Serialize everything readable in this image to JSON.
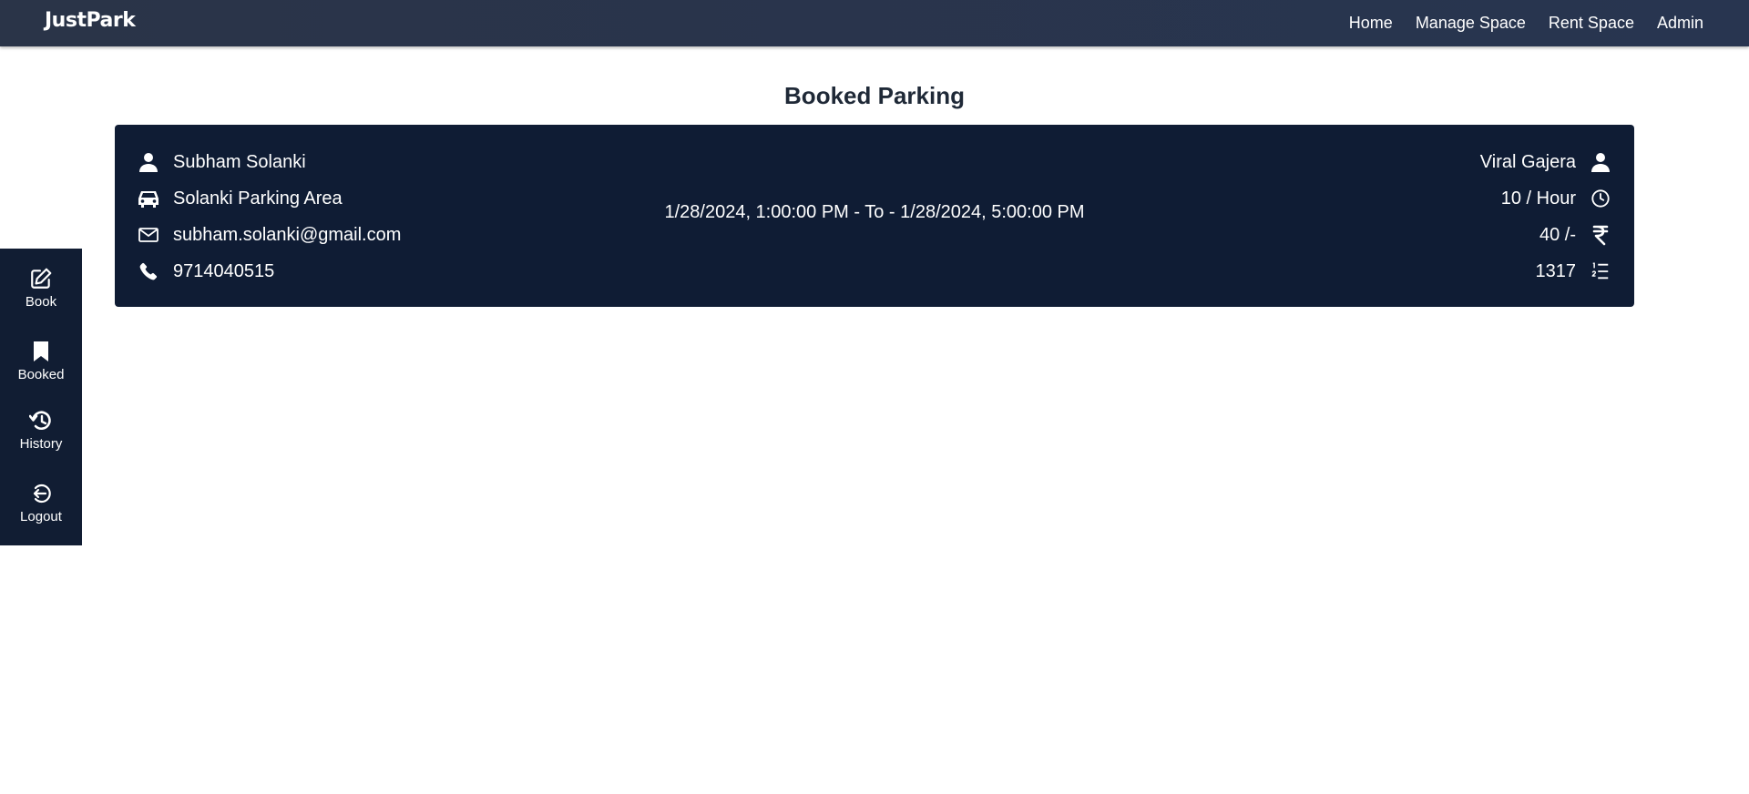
{
  "app": {
    "brand": "JustPark"
  },
  "nav": {
    "items": [
      "Home",
      "Manage Space",
      "Rent Space",
      "Admin"
    ]
  },
  "page": {
    "title": "Booked Parking"
  },
  "booking": {
    "customer_name": "Subham Solanki",
    "parking_area": "Solanki Parking Area",
    "email": "subham.solanki@gmail.com",
    "phone": "9714040515",
    "time_range": "1/28/2024, 1:00:00 PM - To - 1/28/2024, 5:00:00 PM",
    "owner_name": "Viral Gajera",
    "rate": "10 / Hour",
    "amount": "40 /-",
    "booking_number": "1317"
  },
  "sidebar": {
    "items": [
      {
        "label": "Book",
        "icon": "edit-icon"
      },
      {
        "label": "Booked",
        "icon": "bookmark-icon"
      },
      {
        "label": "History",
        "icon": "history-icon"
      },
      {
        "label": "Logout",
        "icon": "logout-icon"
      }
    ]
  },
  "colors": {
    "topbar": "#2a3448",
    "card": "#0f1c34",
    "sidebar": "#111d33",
    "title": "#1f2937"
  }
}
